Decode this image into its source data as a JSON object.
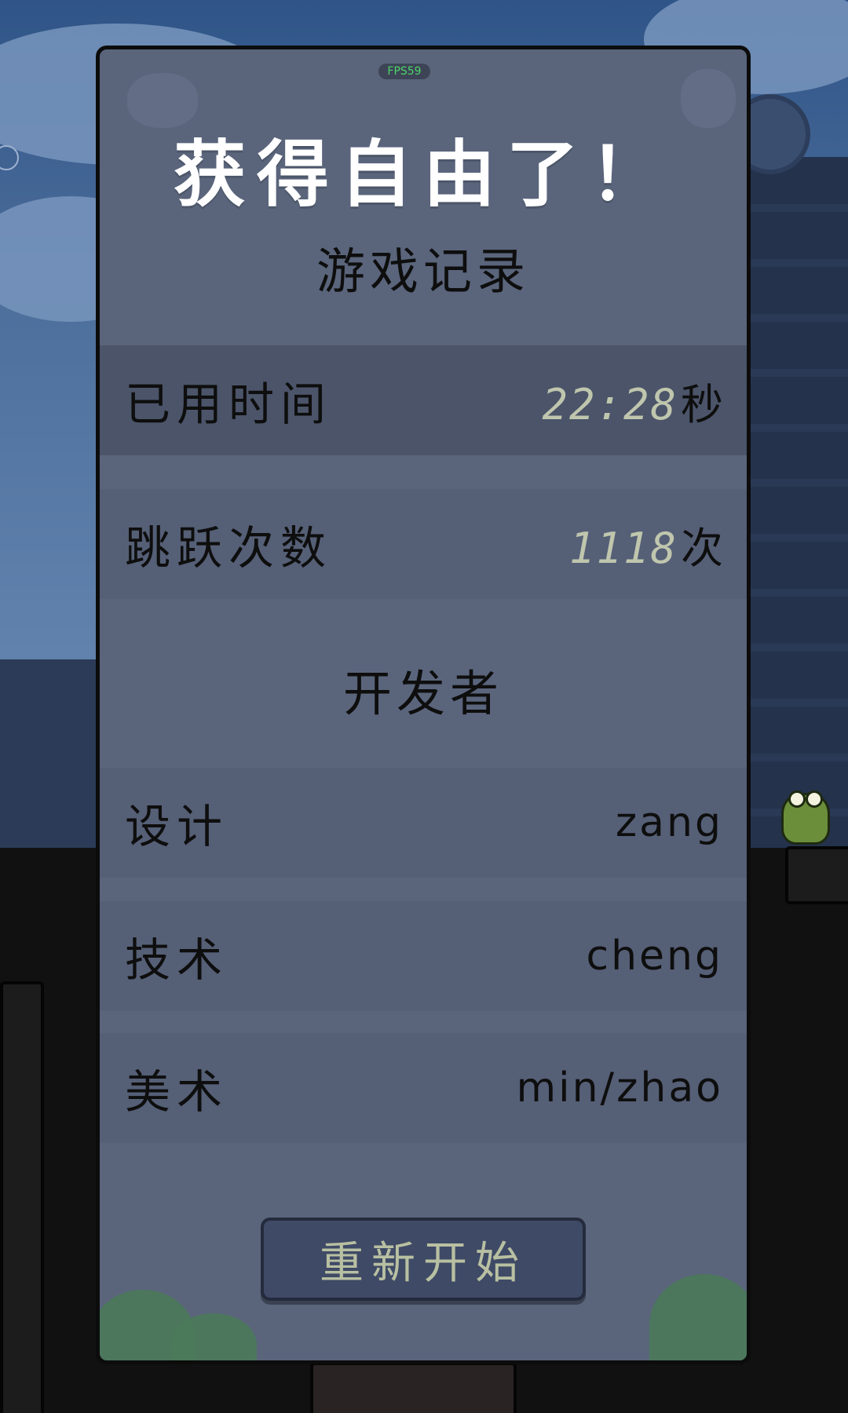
{
  "fps": "FPS59",
  "title": "获得自由了！",
  "records": {
    "heading": "游戏记录",
    "time": {
      "label": "已用时间",
      "value": "22:28",
      "unit": "秒"
    },
    "jumps": {
      "label": "跳跃次数",
      "value": "1118",
      "unit": "次"
    }
  },
  "developers": {
    "heading": "开发者",
    "items": [
      {
        "role": "设计",
        "name": "zang"
      },
      {
        "role": "技术",
        "name": "cheng"
      },
      {
        "role": "美术",
        "name": "min/zhao"
      }
    ]
  },
  "restart_label": "重新开始",
  "colors": {
    "panel": "#5a657c",
    "row": "#555f76",
    "highlight_row": "#4b5469",
    "number": "#bfc6ad",
    "button": "#3f4a66",
    "fps_text": "#4fd36a"
  }
}
